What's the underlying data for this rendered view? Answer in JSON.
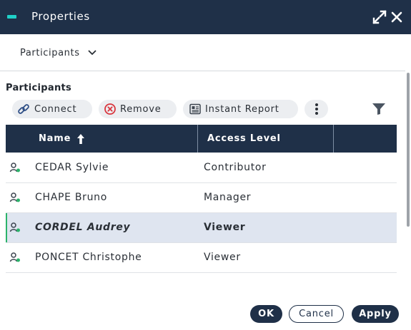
{
  "window": {
    "title": "Properties",
    "icons": {
      "expand": "expand-icon",
      "close": "close-icon"
    }
  },
  "view_selector": {
    "value": "Participants",
    "icon": "chevron-down-icon"
  },
  "section": {
    "title": "Participants"
  },
  "toolbar": {
    "connect_label": "Connect",
    "remove_label": "Remove",
    "report_label": "Instant Report",
    "icons": [
      "link-icon",
      "remove-circle-icon",
      "report-icon",
      "more-vertical-icon",
      "filter-icon"
    ]
  },
  "table": {
    "columns": [
      {
        "label": "Name",
        "sort": "ascending"
      },
      {
        "label": "Access Level"
      },
      {
        "label": ""
      }
    ],
    "rows": [
      {
        "name": "CEDAR Sylvie",
        "access": "Contributor",
        "selected": false
      },
      {
        "name": "CHAPE Bruno",
        "access": "Manager",
        "selected": false
      },
      {
        "name": "CORDEL Audrey",
        "access": "Viewer",
        "selected": true
      },
      {
        "name": "PONCET Christophe",
        "access": "Viewer",
        "selected": false
      }
    ]
  },
  "footer": {
    "ok_label": "OK",
    "cancel_label": "Cancel",
    "apply_label": "Apply"
  },
  "colors": {
    "header_bg": "#1f3048",
    "accent_teal": "#1fd0c8",
    "user_icon_green": "#2bb36a",
    "remove_red": "#d9363e",
    "selected_row_bg": "#dfe5f0"
  }
}
